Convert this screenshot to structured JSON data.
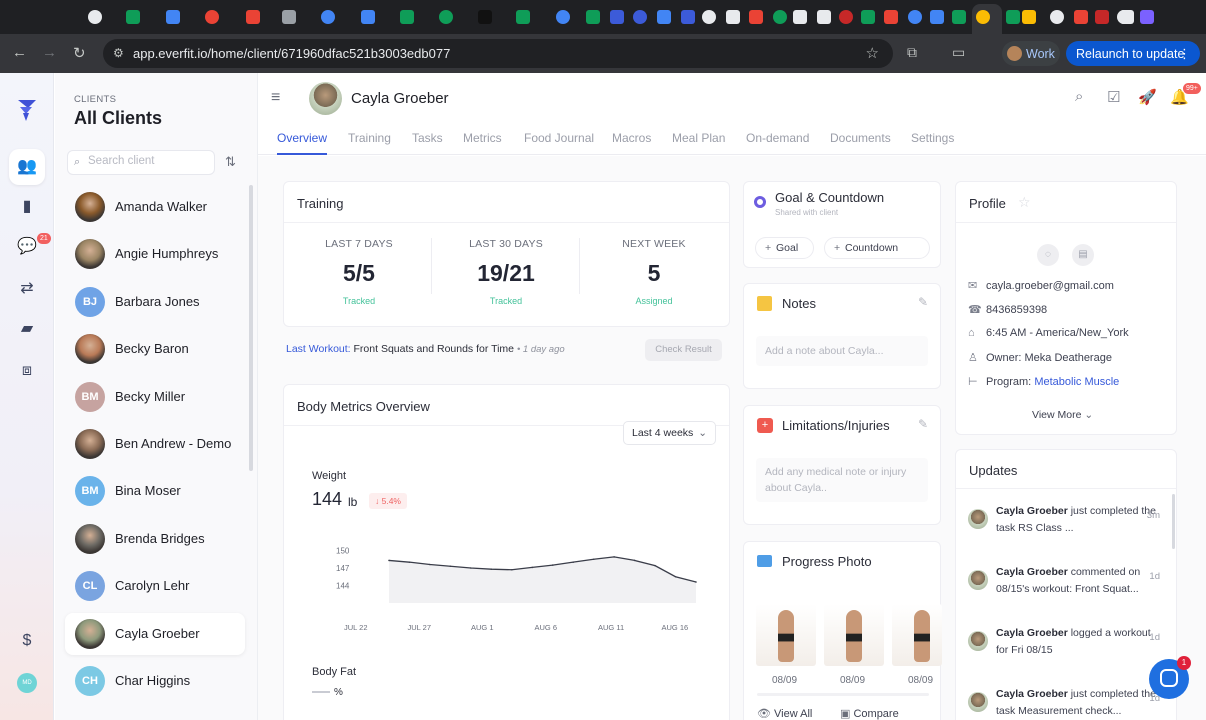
{
  "browser": {
    "url": "app.everfit.io/home/client/671960dfac521b3003edb077",
    "profile_label": "Work",
    "relaunch_label": "Relaunch to update",
    "tab_favicons": [
      "#e8eaed",
      "#0f9d58",
      "#4285f4",
      "#ea4335",
      "#ea4335",
      "#9aa0a6",
      "#4285f4",
      "#4285f4",
      "#0f9d58",
      "#0f9d58",
      "#111111",
      "#0f9d58",
      "#4285f4",
      "#0f9d58",
      "#3c5bd9",
      "#3c5bd9",
      "#4285f4",
      "#3c5bd9",
      "#e8eaed",
      "#e8eaed",
      "#ea4335",
      "#0f9d58",
      "#e8eaed",
      "#e8eaed",
      "#c62828",
      "#0f9d58",
      "#ea4335",
      "#4285f4",
      "#4285f4",
      "#0f9d58",
      "#fbbc04",
      "#0f9d58",
      "#fbbc04",
      "#e8eaed",
      "#ea4335",
      "#c62828",
      "#e8eaed",
      "#e8eaed",
      "#7b61ff"
    ]
  },
  "rail": {
    "messages_badge": "21",
    "avatar_initials": "MD"
  },
  "clients_panel": {
    "caption": "CLIENTS",
    "title": "All Clients",
    "search_placeholder": "Search client",
    "clients": [
      {
        "name": "Amanda Walker",
        "initials": "",
        "color": "#8a5a2b"
      },
      {
        "name": "Angie Humphreys",
        "initials": "",
        "color": "#9b8564"
      },
      {
        "name": "Barbara Jones",
        "initials": "BJ",
        "color": "#6fa3e6"
      },
      {
        "name": "Becky Baron",
        "initials": "",
        "color": "#b97a57"
      },
      {
        "name": "Becky Miller",
        "initials": "BM",
        "color": "#c6a3a0"
      },
      {
        "name": "Ben Andrew - Demo",
        "initials": "",
        "color": "#8a6b55"
      },
      {
        "name": "Bina Moser",
        "initials": "BM",
        "color": "#6ab3ea"
      },
      {
        "name": "Brenda Bridges",
        "initials": "",
        "color": "#6d6a64"
      },
      {
        "name": "Carolyn Lehr",
        "initials": "CL",
        "color": "#7aa4e0"
      },
      {
        "name": "Cayla Groeber",
        "initials": "",
        "color": "#8e9a7c"
      },
      {
        "name": "Char Higgins",
        "initials": "CH",
        "color": "#7cc9e4"
      }
    ]
  },
  "header": {
    "client_name": "Cayla Groeber",
    "notifications_badge": "99+"
  },
  "tabs": [
    "Overview",
    "Training",
    "Tasks",
    "Metrics",
    "Food Journal",
    "Macros",
    "Meal Plan",
    "On-demand",
    "Documents",
    "Settings"
  ],
  "training": {
    "title": "Training",
    "stats": [
      {
        "label": "LAST 7 DAYS",
        "value": "5/5",
        "sub": "Tracked"
      },
      {
        "label": "LAST 30 DAYS",
        "value": "19/21",
        "sub": "Tracked"
      },
      {
        "label": "NEXT WEEK",
        "value": "5",
        "sub": "Assigned"
      }
    ],
    "last_workout_key": "Last Workout:",
    "last_workout_name": "Front Squats and Rounds for Time",
    "last_workout_time": "• 1 day ago",
    "check_result": "Check Result"
  },
  "body_metrics": {
    "title": "Body Metrics Overview",
    "range": "Last 4 weeks",
    "weight_label": "Weight",
    "weight_value": "144",
    "weight_unit": "lb",
    "weight_delta": "↓ 5.4%",
    "body_fat_label": "Body Fat",
    "body_fat_value": "%"
  },
  "chart_data": {
    "type": "line",
    "title": "Weight",
    "x": [
      "JUL 20",
      "JUL 22",
      "JUL 24",
      "JUL 26",
      "JUL 28",
      "JUL 30",
      "AUG 1",
      "AUG 3",
      "AUG 5",
      "AUG 7",
      "AUG 9",
      "AUG 11",
      "AUG 13",
      "AUG 14",
      "AUG 15",
      "AUG 16"
    ],
    "values": [
      148.3,
      148.0,
      147.6,
      147.3,
      147.0,
      146.8,
      146.7,
      147.1,
      147.5,
      148.0,
      148.5,
      148.9,
      148.3,
      147.4,
      145.5,
      144.6
    ],
    "tick_labels": [
      "JUL 22",
      "JUL 27",
      "AUG 1",
      "AUG 6",
      "AUG 11",
      "AUG 16"
    ],
    "y_ticks": [
      "150",
      "147",
      "144"
    ],
    "ylim": [
      141,
      153
    ],
    "series_color": "#3a3d49"
  },
  "goal": {
    "title": "Goal & Countdown",
    "subtitle": "Shared with client",
    "goal_btn": "Goal",
    "countdown_btn": "Countdown"
  },
  "notes": {
    "title": "Notes",
    "placeholder": "Add a note about Cayla..."
  },
  "limitations": {
    "title": "Limitations/Injuries",
    "placeholder": "Add any medical note or injury about Cayla.."
  },
  "progress_photo": {
    "title": "Progress Photo",
    "dates": [
      "08/09",
      "08/09",
      "08/09"
    ],
    "view_all": "View All",
    "compare": "Compare"
  },
  "profile": {
    "title": "Profile",
    "email": "cayla.groeber@gmail.com",
    "phone": "8436859398",
    "timezone": "6:45 AM - America/New_York",
    "owner": "Owner: Meka Deatherage",
    "program_key": "Program:",
    "program_value": "Metabolic Muscle",
    "view_more": "View More"
  },
  "updates": {
    "title": "Updates",
    "items": [
      {
        "name": "Cayla Groeber",
        "text": "just completed the task RS Class ...",
        "time": "3m"
      },
      {
        "name": "Cayla Groeber",
        "text": "commented on 08/15's workout: Front Squat...",
        "time": "1d"
      },
      {
        "name": "Cayla Groeber",
        "text": "logged a workout for Fri 08/15",
        "time": "1d"
      },
      {
        "name": "Cayla Groeber",
        "text": "just completed the task Measurement check...",
        "time": "1d"
      }
    ]
  },
  "chat": {
    "badge": "1"
  }
}
